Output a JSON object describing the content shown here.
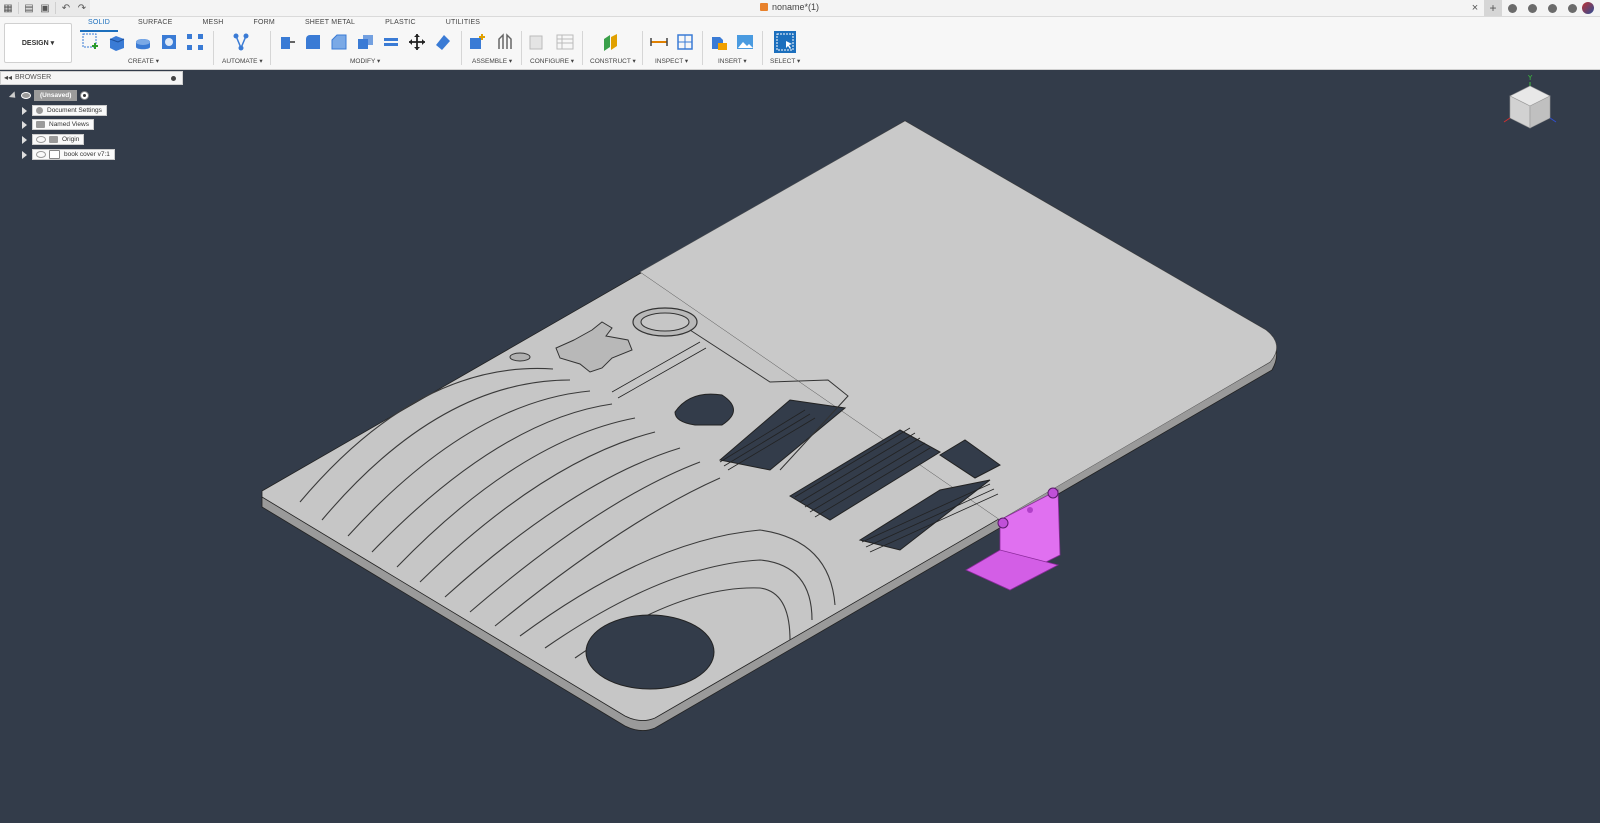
{
  "titlebar": {
    "doc_title": "noname*(1)",
    "close_symbol": "×",
    "new_tab_symbol": "+"
  },
  "ribbon": {
    "workspace": "DESIGN ▾",
    "tabs": [
      {
        "label": "SOLID",
        "active": true
      },
      {
        "label": "SURFACE",
        "active": false
      },
      {
        "label": "MESH",
        "active": false
      },
      {
        "label": "FORM",
        "active": false
      },
      {
        "label": "SHEET METAL",
        "active": false
      },
      {
        "label": "PLASTIC",
        "active": false
      },
      {
        "label": "UTILITIES",
        "active": false
      }
    ],
    "groups": {
      "create": "CREATE ▾",
      "automate": "AUTOMATE ▾",
      "modify": "MODIFY ▾",
      "assemble": "ASSEMBLE ▾",
      "configure": "CONFIGURE ▾",
      "construct": "CONSTRUCT ▾",
      "inspect": "INSPECT ▾",
      "insert": "INSERT ▾",
      "select": "SELECT ▾"
    }
  },
  "browser": {
    "title": "BROWSER",
    "collapse_symbol": "◂◂",
    "root": "(Unsaved)",
    "items": [
      {
        "label": "Document Settings"
      },
      {
        "label": "Named Views"
      },
      {
        "label": "Origin"
      },
      {
        "label": "book cover v7:1"
      }
    ]
  },
  "viewcube": {
    "axis_y": "Y",
    "accent": "#00a000"
  },
  "colors": {
    "viewport": "#333c4a",
    "part": "#c6c6c6",
    "selection": "#e070f0",
    "accent": "#1c6fbd"
  }
}
